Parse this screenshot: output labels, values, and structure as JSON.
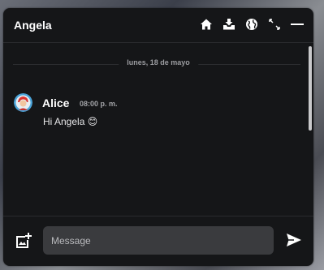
{
  "header": {
    "title": "Angela",
    "icons": [
      "home-icon",
      "inbox-icon",
      "globe-icon",
      "expand-icon",
      "minimize-icon"
    ]
  },
  "conversation": {
    "date_label": "lunes, 18 de mayo",
    "messages": [
      {
        "author": "Alice",
        "time": "08:00 p. m.",
        "text": "Hi Angela 😊"
      }
    ]
  },
  "composer": {
    "placeholder": "Message",
    "value": ""
  },
  "colors": {
    "window_bg": "#151618",
    "input_bg": "#3a3b3e",
    "text": "#ffffff",
    "muted": "#9c9da1"
  }
}
